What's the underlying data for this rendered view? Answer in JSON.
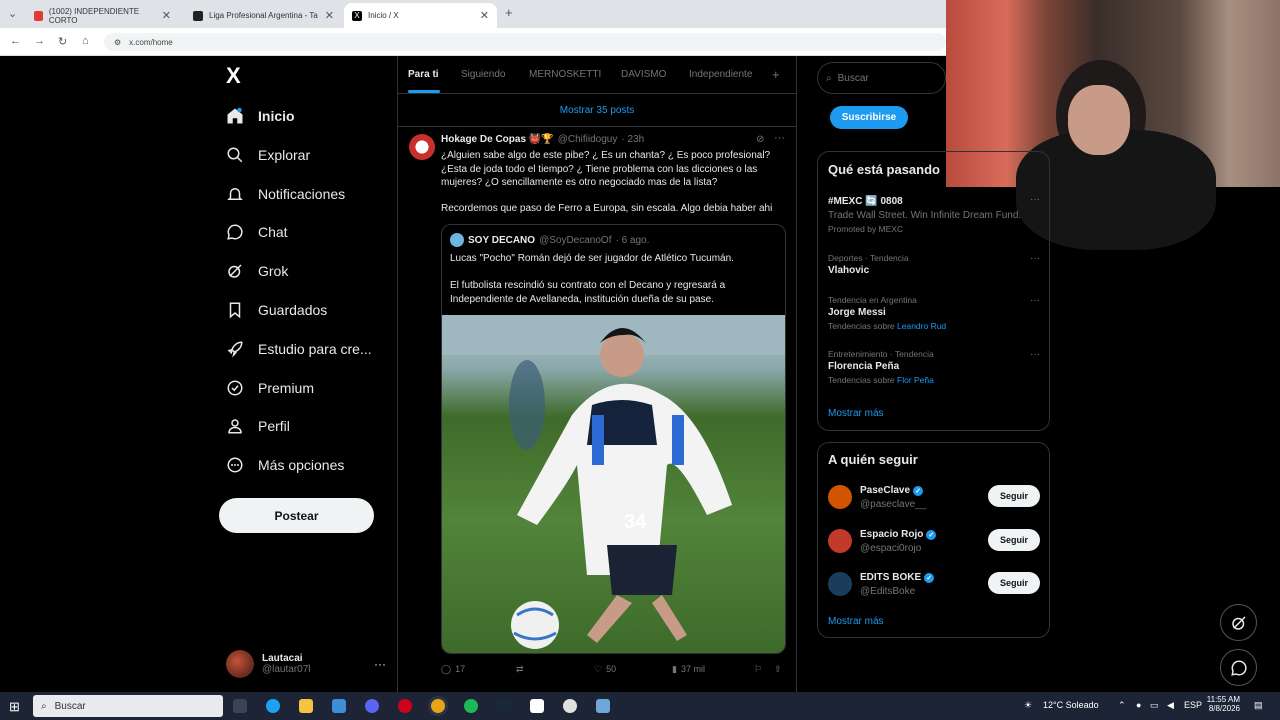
{
  "browser": {
    "tabs": [
      {
        "label": "(1002) INDEPENDIENTE CORTO",
        "color": "#e53935"
      },
      {
        "label": "Liga Profesional Argentina - Ta",
        "color": "#222"
      },
      {
        "label": "Inicio / X",
        "color": "#000"
      }
    ],
    "url": "x.com/home"
  },
  "sidebar": {
    "logo": "X",
    "items": [
      {
        "label": "Inicio",
        "icon": "home-icon"
      },
      {
        "label": "Explorar",
        "icon": "search-icon"
      },
      {
        "label": "Notificaciones",
        "icon": "bell-icon"
      },
      {
        "label": "Chat",
        "icon": "chat-icon"
      },
      {
        "label": "Grok",
        "icon": "grok-icon"
      },
      {
        "label": "Guardados",
        "icon": "bookmark-icon"
      },
      {
        "label": "Estudio para cre...",
        "icon": "rocket-icon"
      },
      {
        "label": "Premium",
        "icon": "premium-icon"
      },
      {
        "label": "Perfil",
        "icon": "person-icon"
      },
      {
        "label": "Más opciones",
        "icon": "more-icon"
      }
    ],
    "post_button": "Postear",
    "account": {
      "name": "Lautacai",
      "handle": "@lautar07l"
    }
  },
  "feed": {
    "tabs": [
      "Para ti",
      "Siguiendo",
      "MERNOSKETTI",
      "DAVISMO",
      "Independiente"
    ],
    "show_more": "Mostrar 35 posts",
    "tweet": {
      "name": "Hokage De Copas 👹🏆",
      "handle": "@Chifiidoguy",
      "time": "· 23h",
      "text1": "¿Alguien sabe algo de este pibe? ¿ Es un chanta? ¿ Es poco profesional? ¿Esta de joda todo el tiempo? ¿ Tiene problema con las dicciones o las mujeres? ¿O sencillamente es otro negociado mas de la lista?",
      "text2": "Recordemos que paso de Ferro a Europa, sin escala. Algo debia haber ahi",
      "quote": {
        "name": "SOY DECANO",
        "handle": "@SoyDecanoOf",
        "time": "· 6 ago.",
        "text1": "Lucas \"Pocho\" Román dejó de ser jugador de Atlético Tucumán.",
        "text2": "El futbolista rescindió su contrato con el Decano y regresará a Independiente de Avellaneda, institución dueña de su pase."
      },
      "replies": "17",
      "likes": "50",
      "views": "37 mil",
      "jersey_number": "34"
    }
  },
  "right": {
    "search_placeholder": "Buscar",
    "subscribe": "Suscribirse",
    "trends_title": "Qué está pasando",
    "trends": [
      {
        "ctx": "",
        "name": "#MEXC 🔄 0808",
        "sub": "Trade Wall Street. Win Infinite Dream Fund.",
        "sub2": "Promoted by MEXC",
        "link": ""
      },
      {
        "ctx": "Deportes · Tendencia",
        "name": "Vlahovic",
        "sub": "",
        "sub2": "",
        "link": ""
      },
      {
        "ctx": "Tendencia en Argentina",
        "name": "Jorge Messi",
        "sub": "Tendencias sobre",
        "sub2": "",
        "link": "Leandro Rud"
      },
      {
        "ctx": "Entretenimiento · Tendencia",
        "name": "Florencia Peña",
        "sub": "Tendencias sobre",
        "sub2": "",
        "link": "Flor Peña"
      }
    ],
    "trends_more": "Mostrar más",
    "follow_title": "A quién seguir",
    "follow": [
      {
        "name": "PaseClave",
        "handle": "@paseclave__",
        "color": "#d35400"
      },
      {
        "name": "Espacio Rojo",
        "handle": "@espaci0rojo",
        "color": "#c0392b"
      },
      {
        "name": "EDITS BOKE",
        "handle": "@EditsBoke",
        "color": "#1a3d5c"
      }
    ],
    "follow_btn": "Seguir",
    "follow_more": "Mostrar más"
  },
  "taskbar": {
    "search": "Buscar",
    "weather": "12°C Soleado",
    "lang": "ESP",
    "time": "11:55 AM",
    "date": "8/8/2026"
  }
}
